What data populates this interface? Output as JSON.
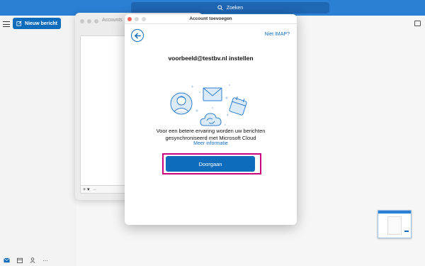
{
  "topbar": {
    "search_label": "Zoeken"
  },
  "sidebar": {
    "new_mail_label": "Nieuw bericht"
  },
  "accounts_window": {
    "title": "Accounts",
    "add_label": "+ ▾",
    "remove_label": "–"
  },
  "dialog": {
    "title": "Account toevoegen",
    "not_imap": "Niet IMAP?",
    "heading": "voorbeeld@testbv.nl instellen",
    "info_line1": "Voor een betere ervaring worden uw berichten",
    "info_line2": "gesynchroniseerd met Microsoft Cloud",
    "more_info": "Meer informatie",
    "continue_label": "Doorgaan"
  },
  "bottom_nav": {
    "more_label": "···"
  },
  "colors": {
    "accent": "#0f6cbd",
    "topbar": "#2b7fd4",
    "highlight": "#c8007f",
    "close_dot": "#ff5f57"
  },
  "icons": [
    "search-icon",
    "hamburger-icon",
    "compose-icon",
    "back-arrow-icon",
    "mail-icon",
    "calendar-icon",
    "people-icon",
    "more-icon",
    "sidebar-toggle-icon"
  ]
}
